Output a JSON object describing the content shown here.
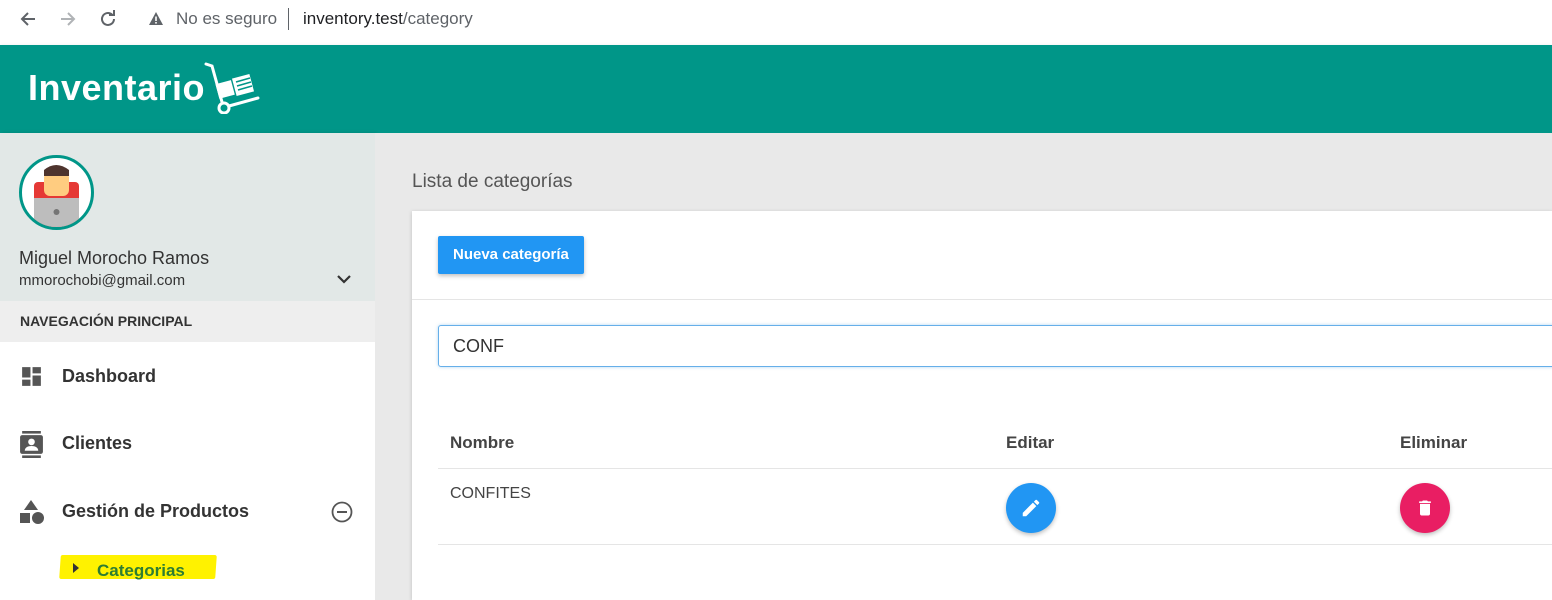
{
  "browser": {
    "security_label": "No es seguro",
    "url_host": "inventory.test",
    "url_path": "/category"
  },
  "header": {
    "logo_text": "Inventario"
  },
  "sidebar": {
    "user_name": "Miguel Morocho Ramos",
    "user_email": "mmorochobi@gmail.com",
    "nav_header": "NAVEGACIÓN PRINCIPAL",
    "items": [
      {
        "label": "Dashboard",
        "icon": "dashboard-icon"
      },
      {
        "label": "Clientes",
        "icon": "contacts-icon"
      },
      {
        "label": "Gestión de Productos",
        "icon": "shapes-icon",
        "expanded": true
      }
    ],
    "subitems": [
      {
        "label": "Categorias",
        "active": true
      }
    ]
  },
  "main": {
    "page_title": "Lista de categorías",
    "new_button_label": "Nueva categoría",
    "search_value": "CONF",
    "table": {
      "headers": [
        "Nombre",
        "Editar",
        "Eliminar"
      ],
      "rows": [
        {
          "name": "CONFITES"
        }
      ]
    }
  },
  "colors": {
    "primary": "#009688",
    "accent_blue": "#2196f3",
    "danger": "#e91e63",
    "highlight": "#fff200"
  }
}
